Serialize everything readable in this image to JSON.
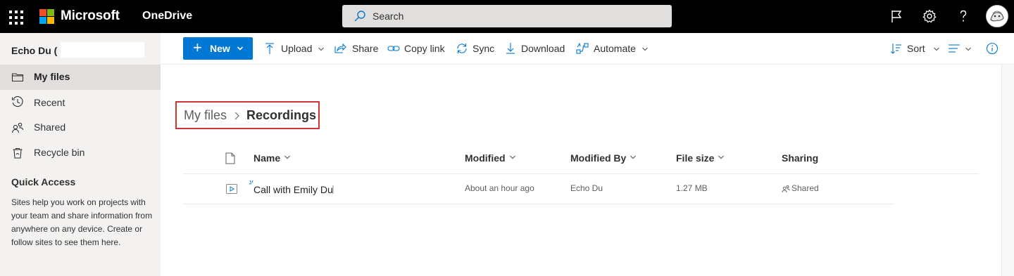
{
  "topbar": {
    "brand": "Microsoft",
    "app_name": "OneDrive",
    "search_placeholder": "Search",
    "colors": {
      "background": "#000000",
      "search_bg": "#e1dfdd"
    },
    "icons": [
      "app-launcher-icon",
      "flag-icon",
      "settings-gear-icon",
      "help-icon"
    ]
  },
  "leftnav": {
    "user_name": "Echo Du (",
    "items": [
      {
        "label": "My files",
        "icon": "folder-icon",
        "active": true
      },
      {
        "label": "Recent",
        "icon": "history-icon",
        "active": false
      },
      {
        "label": "Shared",
        "icon": "people-icon",
        "active": false
      },
      {
        "label": "Recycle bin",
        "icon": "recycle-bin-icon",
        "active": false
      }
    ],
    "quick_access_title": "Quick Access",
    "quick_access_text": "Sites help you work on projects with your team and share information from anywhere on any device. Create or follow sites to see them here."
  },
  "commandbar": {
    "new_label": "New",
    "upload_label": "Upload",
    "share_label": "Share",
    "copy_link_label": "Copy link",
    "sync_label": "Sync",
    "download_label": "Download",
    "automate_label": "Automate",
    "sort_label": "Sort",
    "accent_color": "#0078d4"
  },
  "breadcrumb": {
    "root": "My files",
    "current": "Recordings",
    "highlight_color": "#d13438"
  },
  "table": {
    "columns": {
      "name": "Name",
      "modified": "Modified",
      "modified_by": "Modified By",
      "file_size": "File size",
      "sharing": "Sharing"
    },
    "rows": [
      {
        "name": "Call with Emily Du",
        "modified": "About an hour ago",
        "modified_by": "Echo Du",
        "file_size": "1.27 MB",
        "sharing": "Shared"
      }
    ]
  }
}
